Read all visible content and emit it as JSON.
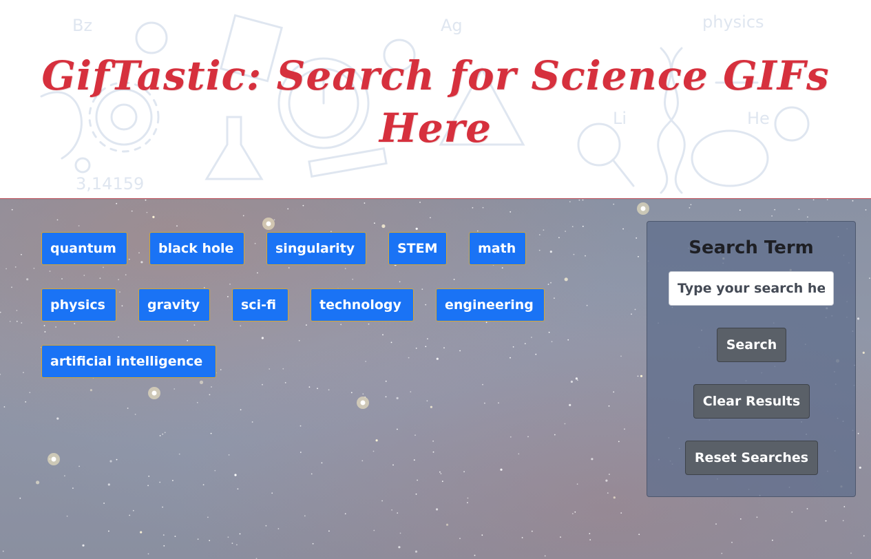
{
  "header": {
    "title_line1": "GifTastic: Search for Science GIFs",
    "title_line2": "Here"
  },
  "topics": [
    {
      "label": "quantum"
    },
    {
      "label": "black hole"
    },
    {
      "label": "singularity"
    },
    {
      "label": "STEM"
    },
    {
      "label": "math"
    },
    {
      "label": "physics"
    },
    {
      "label": "gravity"
    },
    {
      "label": "sci-fi"
    },
    {
      "label": "technology"
    },
    {
      "label": "engineering"
    },
    {
      "label": "artificial intelligence"
    }
  ],
  "search_panel": {
    "title": "Search Term",
    "input_placeholder": "Type your search here",
    "input_value": "",
    "search_label": "Search",
    "clear_label": "Clear Results",
    "reset_label": "Reset Searches"
  },
  "colors": {
    "title_red": "#d6303d",
    "topic_button_blue": "#1a73f5",
    "topic_button_border": "#d4a736",
    "panel_button_gray": "#5a6068"
  }
}
